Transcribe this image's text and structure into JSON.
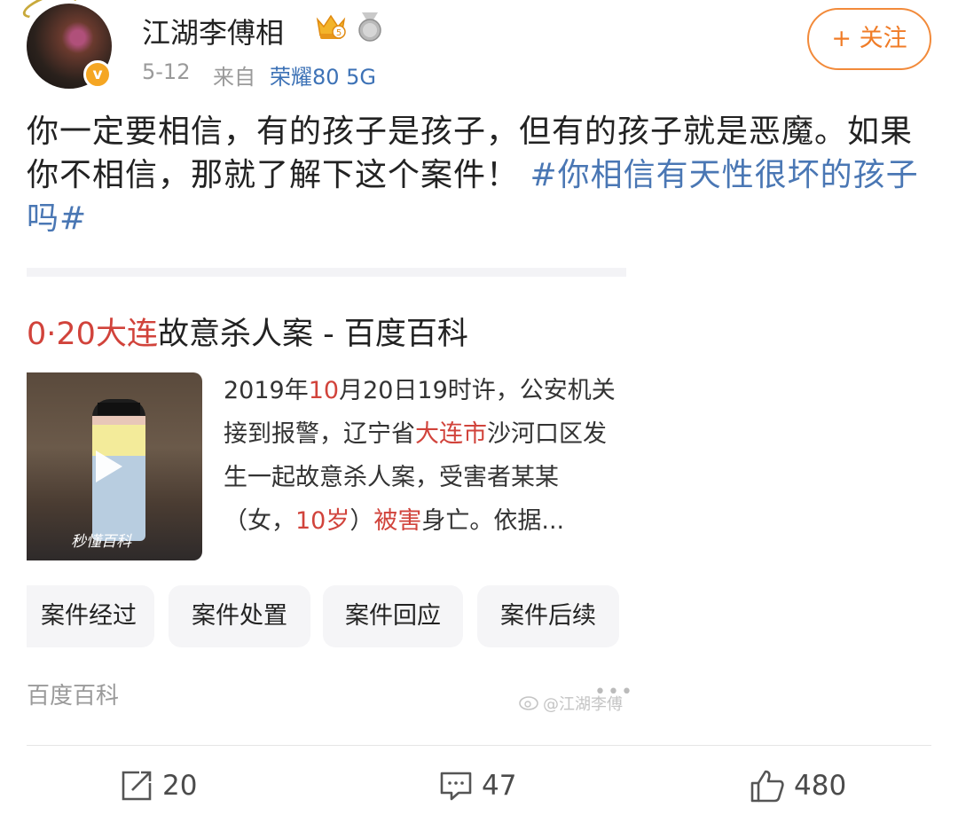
{
  "header": {
    "username": "江湖李傅相",
    "date": "5-12",
    "from_label": "来自",
    "device": "荣耀80 5G",
    "verified_badge": "v",
    "follow_label": "+ 关注",
    "icons": [
      "crown-vip-icon",
      "medal-icon",
      "verified-badge-icon"
    ]
  },
  "post": {
    "text_before_tag": "你一定要相信，有的孩子是孩子，但有的孩子就是恶魔。如果你不相信，那就了解下这个案件！ ",
    "hashtag": "#你相信有天性很坏的孩子吗#"
  },
  "card": {
    "title_p1": "0·20",
    "title_p2": "大连",
    "title_p3": "故意杀人案 - 百度百科",
    "thumb_watermark": "秒懂百科",
    "desc_p1": "2019年",
    "desc_p2": "10",
    "desc_p3": "月20日19时许，公安机关接到报警，辽宁省",
    "desc_p4": "大连市",
    "desc_p5": "沙河口区发生一起故意杀人案，受害者某某（女，",
    "desc_p6": "10岁",
    "desc_p7": "）",
    "desc_p8": "被害",
    "desc_p9": "身亡。依据...",
    "chips": [
      "案件经过",
      "案件处置",
      "案件回应",
      "案件后续"
    ],
    "source": "百度百科",
    "watermark": "@江湖李傅"
  },
  "footer": {
    "repost_count": "20",
    "comment_count": "47",
    "like_count": "480"
  },
  "colors": {
    "link": "#4a77b4",
    "highlight_red": "#d1433b",
    "follow_orange": "#f07c27",
    "muted": "#9a9a9a"
  }
}
